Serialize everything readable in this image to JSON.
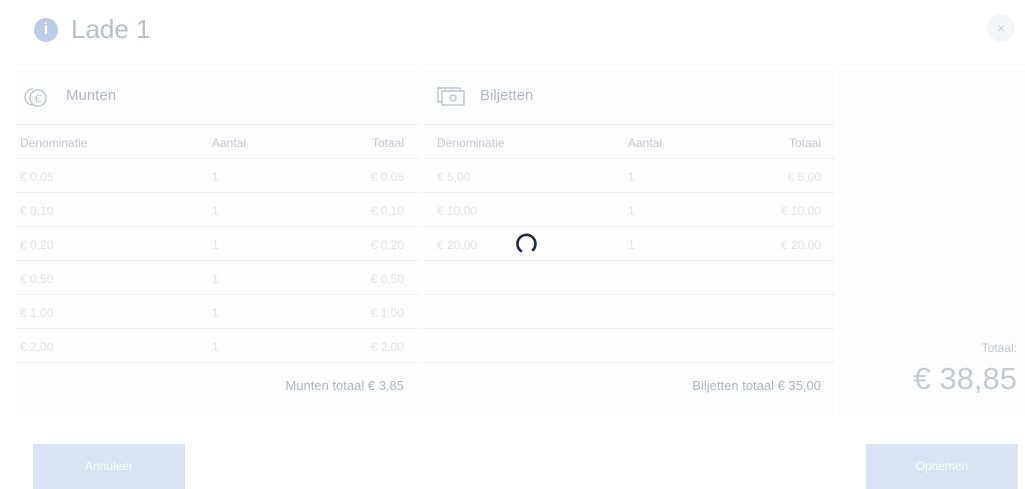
{
  "header": {
    "title": "Lade 1",
    "info_icon": "i",
    "close_label": "×"
  },
  "coins": {
    "title": "Munten",
    "icon": "coins-euro-icon",
    "columns": [
      "Denominatie",
      "Aantal",
      "Totaal"
    ],
    "rows": [
      [
        "€ 0,05",
        "1",
        "€ 0,05"
      ],
      [
        "€ 0,10",
        "1",
        "€ 0,10"
      ],
      [
        "€ 0,20",
        "1",
        "€ 0,20"
      ],
      [
        "€ 0,50",
        "1",
        "€ 0,50"
      ],
      [
        "€ 1,00",
        "1",
        "€ 1,00"
      ],
      [
        "€ 2,00",
        "1",
        "€ 2,00"
      ]
    ],
    "subtotal": "Munten totaal € 3,85"
  },
  "notes": {
    "title": "Biljetten",
    "icon": "banknote-icon",
    "columns": [
      "Denominatie",
      "Aantal",
      "Totaal"
    ],
    "rows": [
      [
        "€ 5,00",
        "1",
        "€ 5,00"
      ],
      [
        "€ 10,00",
        "1",
        "€ 10,00"
      ],
      [
        "€ 20,00",
        "1",
        "€ 20,00"
      ]
    ],
    "subtotal": "Biljetten totaal € 35,00"
  },
  "summary": {
    "label": "Totaal:",
    "value": "€ 38,85"
  },
  "buttons": {
    "cancel": "Annuleer",
    "take": "Opnemen"
  },
  "colors": {
    "button_bg": "#d8e4f3",
    "info_icon": "#b9cde9",
    "spinner": "#1f2a44"
  }
}
